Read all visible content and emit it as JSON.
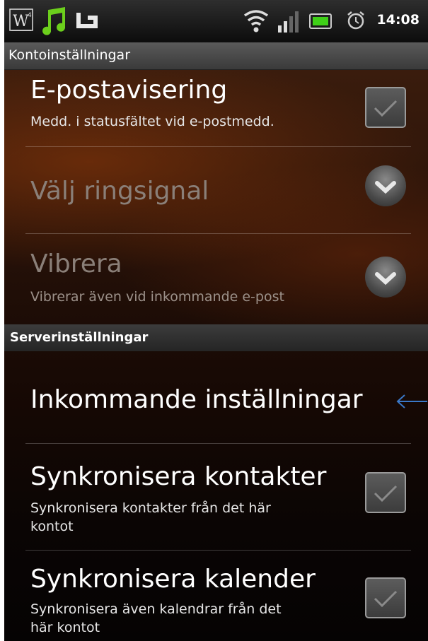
{
  "status_bar": {
    "time": "14:08",
    "icons": [
      "w-app-icon",
      "music-icon",
      "app-icon",
      "wifi-icon",
      "signal-icon",
      "battery-icon",
      "alarm-icon"
    ]
  },
  "title_bar": {
    "title": "Kontoinställningar"
  },
  "items": [
    {
      "title": "E-postavisering",
      "subtitle": "Medd. i statusfältet vid e-postmedd.",
      "control": "checkbox",
      "checked": true,
      "enabled": true
    },
    {
      "title": "Välj ringsignal",
      "control": "dropdown",
      "enabled": false
    },
    {
      "title": "Vibrera",
      "subtitle": "Vibrerar även vid inkommande e-post",
      "control": "dropdown",
      "enabled": false
    }
  ],
  "section": {
    "label": "Serverinställningar"
  },
  "server_items": [
    {
      "title": "Inkommande inställningar",
      "arrow_color": "#3a78c8"
    },
    {
      "title": "Synkronisera kontakter",
      "subtitle_line1": "Synkronisera kontakter från det här",
      "subtitle_line2": "kontot",
      "control": "checkbox",
      "checked": true
    },
    {
      "title": "Synkronisera kalender",
      "subtitle_line1": "Synkronisera även kalendrar från det",
      "subtitle_line2": "här kontot",
      "control": "checkbox",
      "checked": true
    }
  ],
  "colors": {
    "accent_arrow": "#3a78c8",
    "music_icon": "#6ccf1c"
  }
}
